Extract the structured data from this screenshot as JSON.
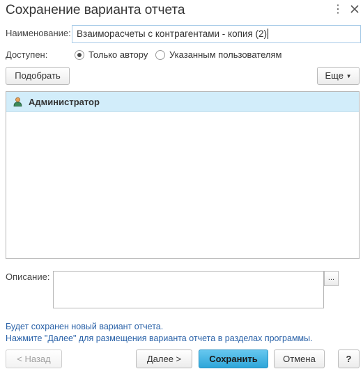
{
  "window": {
    "title": "Сохранение варианта отчета",
    "more_icon": "⋮",
    "close_icon": "close-icon"
  },
  "form": {
    "name_label": "Наименование:",
    "name_value": "Взаиморасчеты с контрагентами - копия (2)",
    "available_label": "Доступен:",
    "radio_author": "Только автору",
    "radio_users": "Указанным пользователям",
    "selected": "author"
  },
  "toolbar": {
    "pick_label": "Подобрать",
    "more_label": "Еще"
  },
  "users": [
    {
      "name": "Администратор",
      "icon": "user-icon"
    }
  ],
  "description": {
    "label": "Описание:",
    "value": "",
    "ellipsis": "..."
  },
  "info": {
    "line1": "Будет сохранен новый вариант отчета.",
    "line2": "Нажмите \"Далее\" для размещения варианта отчета в разделах программы."
  },
  "buttons": {
    "back": "< Назад",
    "next": "Далее >",
    "save": "Сохранить",
    "cancel": "Отмена",
    "help": "?"
  },
  "colors": {
    "accent": "#2ea6d9",
    "selection": "#d2edfa",
    "info_text": "#2a62a8"
  }
}
